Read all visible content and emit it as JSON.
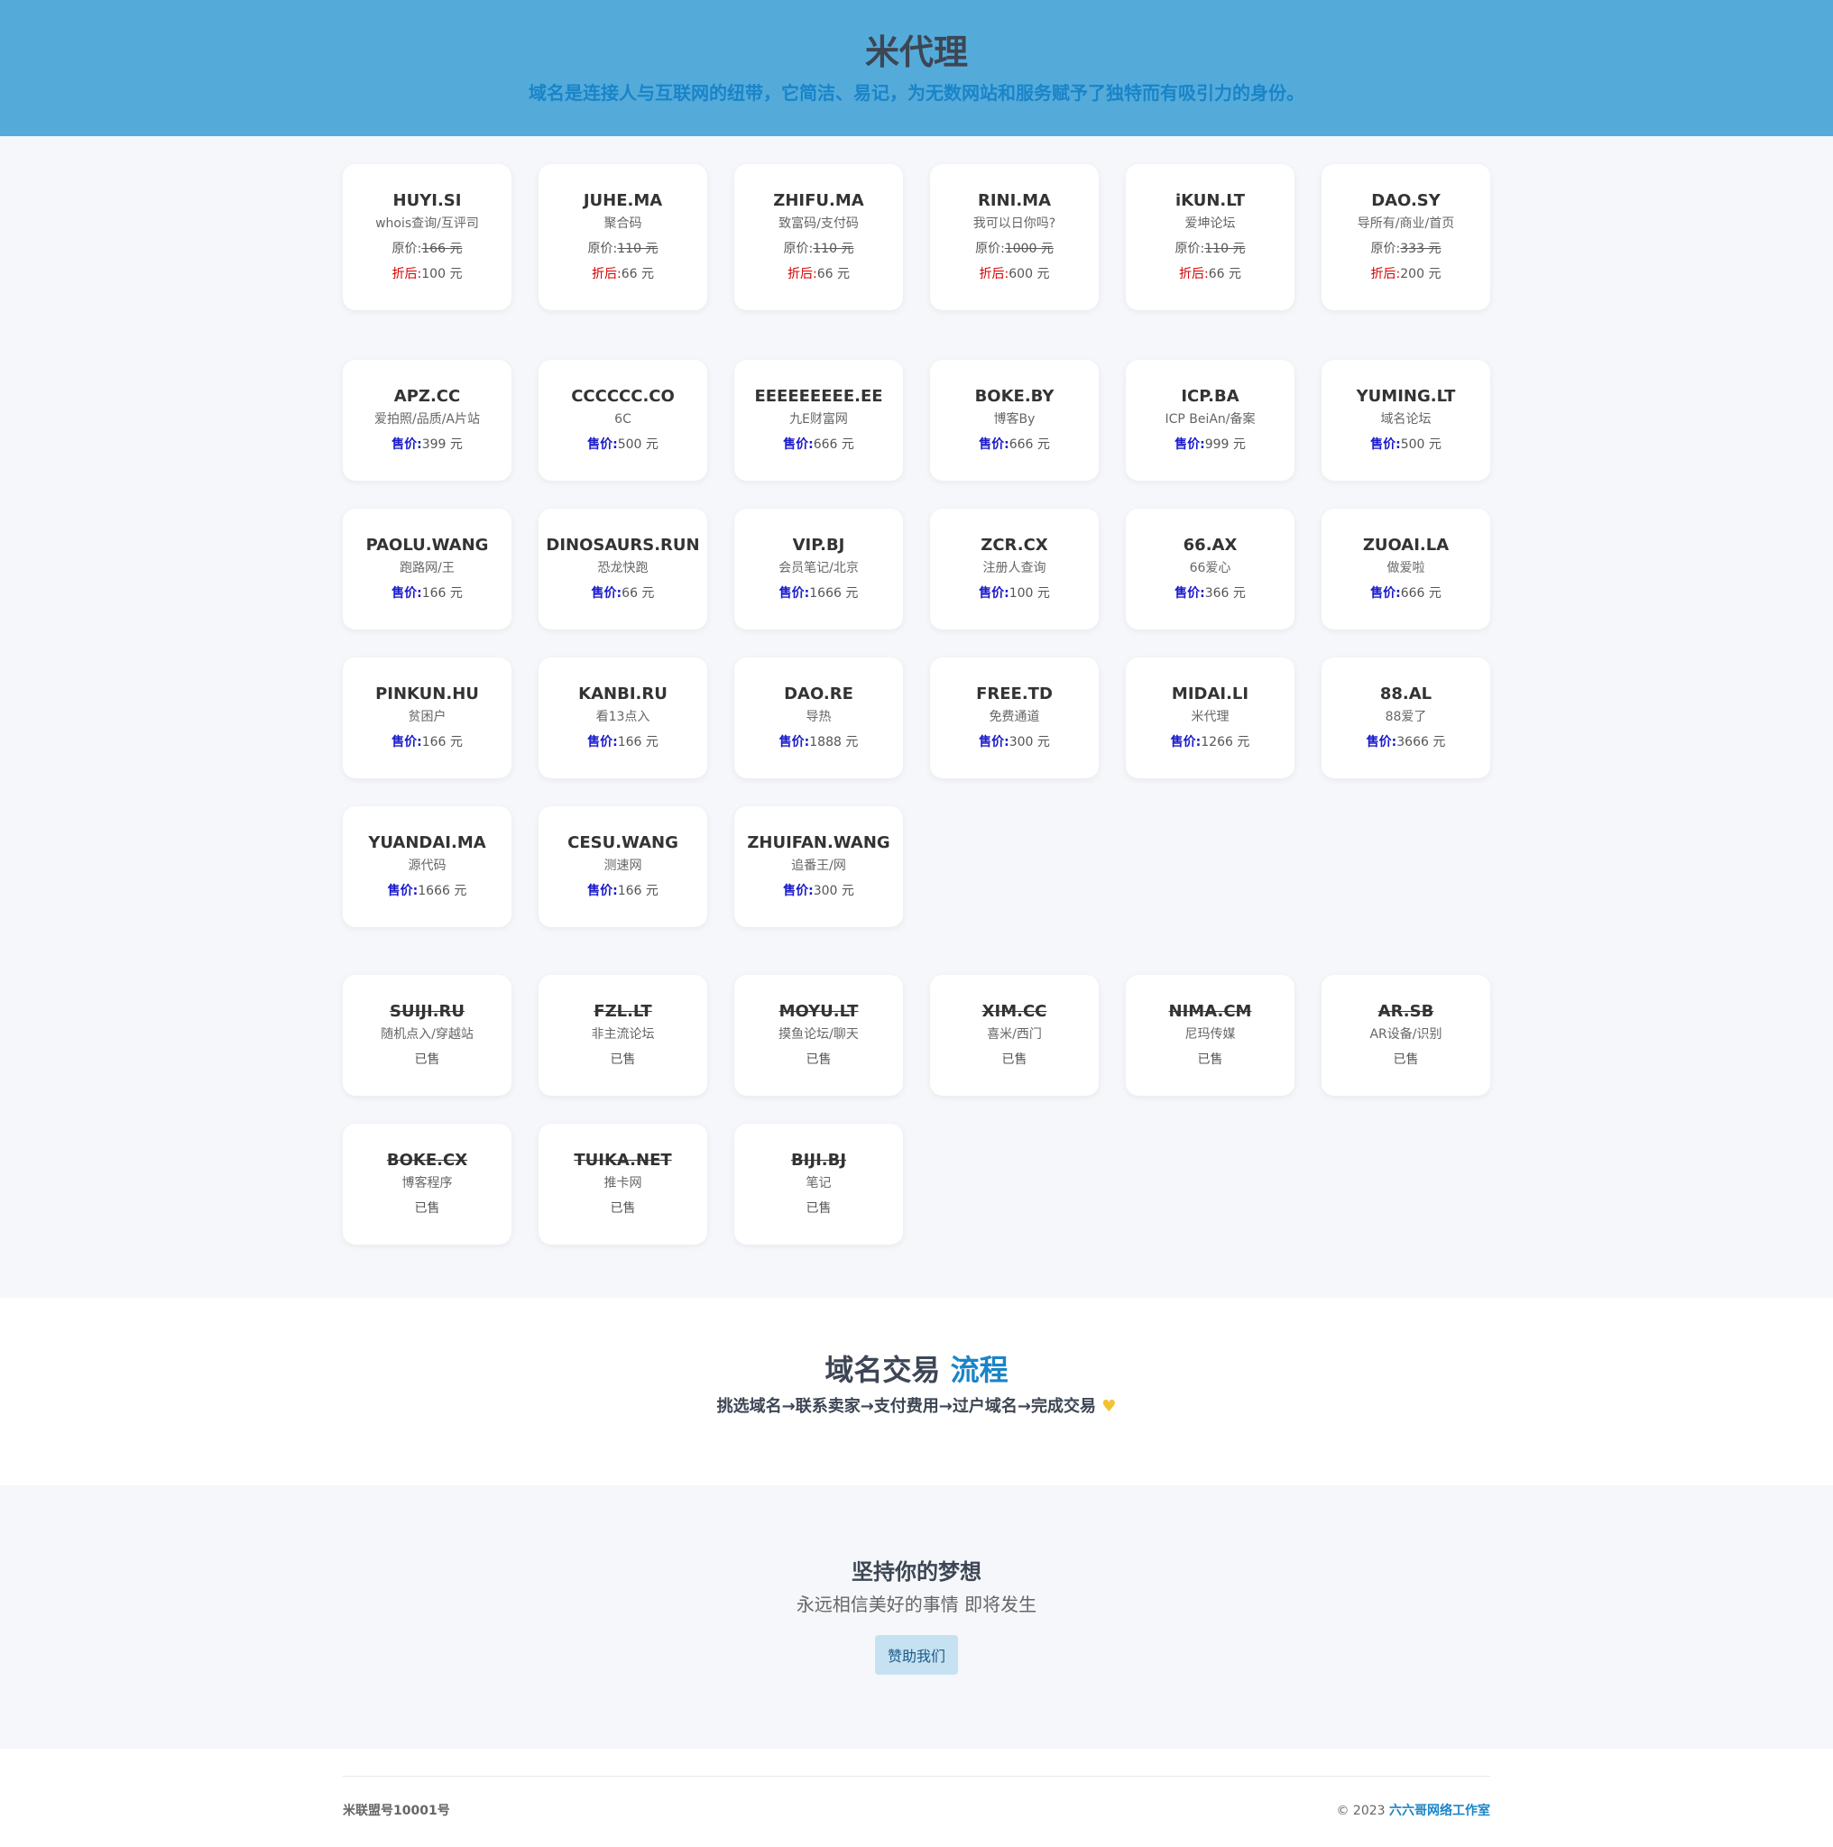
{
  "header": {
    "title": "米代理",
    "subtitle": "域名是连接人与互联网的纽带，它简洁、易记，为无数网站和服务赋予了独特而有吸引力的身份。"
  },
  "labels": {
    "original_price": "原价:",
    "discount_price": "折后:",
    "sale_price": "售价:",
    "currency": " 元",
    "sold": "已售"
  },
  "discounted": [
    {
      "name": "HUYI.SI",
      "desc": "whois查询/互评司",
      "original": "166",
      "discount": "100"
    },
    {
      "name": "JUHE.MA",
      "desc": "聚合码",
      "original": "110",
      "discount": "66"
    },
    {
      "name": "ZHIFU.MA",
      "desc": "致富码/支付码",
      "original": "110",
      "discount": "66"
    },
    {
      "name": "RINI.MA",
      "desc": "我可以日你吗?",
      "original": "1000",
      "discount": "600"
    },
    {
      "name": "iKUN.LT",
      "desc": "爱坤论坛",
      "original": "110",
      "discount": "66"
    },
    {
      "name": "DAO.SY",
      "desc": "导所有/商业/首页",
      "original": "333",
      "discount": "200"
    }
  ],
  "for_sale": [
    {
      "name": "APZ.CC",
      "desc": "爱拍照/品质/A片站",
      "price": "399"
    },
    {
      "name": "CCCCCC.CO",
      "desc": "6C",
      "price": "500"
    },
    {
      "name": "EEEEEEEEE.EE",
      "desc": "九E财富网",
      "price": "666"
    },
    {
      "name": "BOKE.BY",
      "desc": "博客By",
      "price": "666"
    },
    {
      "name": "ICP.BA",
      "desc": "ICP BeiAn/备案",
      "price": "999"
    },
    {
      "name": "YUMING.LT",
      "desc": "域名论坛",
      "price": "500"
    },
    {
      "name": "PAOLU.WANG",
      "desc": "跑路网/王",
      "price": "166"
    },
    {
      "name": "DINOSAURS.RUN",
      "desc": "恐龙快跑",
      "price": "66"
    },
    {
      "name": "VIP.BJ",
      "desc": "会员笔记/北京",
      "price": "1666"
    },
    {
      "name": "ZCR.CX",
      "desc": "注册人查询",
      "price": "100"
    },
    {
      "name": "66.AX",
      "desc": "66爱心",
      "price": "366"
    },
    {
      "name": "ZUOAI.LA",
      "desc": "做爱啦",
      "price": "666"
    },
    {
      "name": "PINKUN.HU",
      "desc": "贫困户",
      "price": "166"
    },
    {
      "name": "KANBI.RU",
      "desc": "看13点入",
      "price": "166"
    },
    {
      "name": "DAO.RE",
      "desc": "导热",
      "price": "1888"
    },
    {
      "name": "FREE.TD",
      "desc": "免费通道",
      "price": "300"
    },
    {
      "name": "MIDAI.LI",
      "desc": "米代理",
      "price": "1266"
    },
    {
      "name": "88.AL",
      "desc": "88爱了",
      "price": "3666"
    },
    {
      "name": "YUANDAI.MA",
      "desc": "源代码",
      "price": "1666"
    },
    {
      "name": "CESU.WANG",
      "desc": "测速网",
      "price": "166"
    },
    {
      "name": "ZHUIFAN.WANG",
      "desc": "追番王/网",
      "price": "300"
    }
  ],
  "sold": [
    {
      "name": "SUIJI.RU",
      "desc": "随机点入/穿越站"
    },
    {
      "name": "FZL.LT",
      "desc": "非主流论坛"
    },
    {
      "name": "MOYU.LT",
      "desc": "摸鱼论坛/聊天"
    },
    {
      "name": "XIM.CC",
      "desc": "喜米/西门"
    },
    {
      "name": "NIMA.CM",
      "desc": "尼玛传媒"
    },
    {
      "name": "AR.SB",
      "desc": "AR设备/识别"
    },
    {
      "name": "BOKE.CX",
      "desc": "博客程序"
    },
    {
      "name": "TUIKA.NET",
      "desc": "推卡网"
    },
    {
      "name": "BIJI.BJ",
      "desc": "笔记"
    }
  ],
  "process": {
    "title_main": "域名交易",
    "title_accent": "流程",
    "steps": "挑选域名→联系卖家→支付费用→过户域名→完成交易",
    "heart_icon": "yellow-heart"
  },
  "dream": {
    "title": "坚持你的梦想",
    "subtitle": "永远相信美好的事情 即将发生",
    "button": "赞助我们"
  },
  "footer": {
    "icp": "米联盟号10001号",
    "copyright_prefix": "© 2023 ",
    "studio": "六六哥网络工作室"
  },
  "colors": {
    "header_bg": "#54abda",
    "accent": "#1a84c8",
    "discount_label": "#d40000",
    "sale_label": "#1a1acc"
  }
}
